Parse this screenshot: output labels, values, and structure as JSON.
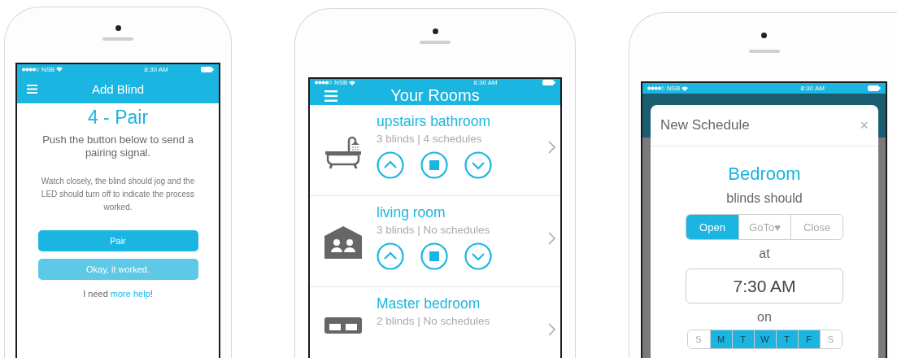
{
  "phones": [
    {
      "kind": "add_blind",
      "status": {
        "carrier": "NSB",
        "time": "8:30 AM"
      },
      "title": "Add Blind",
      "step": "4 - Pair",
      "instruction": "Push the button below to send a pairing signal.",
      "note": "Watch closely, the blind should jog and the LED should turn off to indicate the process worked.",
      "buttons": [
        {
          "label": "Pair",
          "disabled": false
        },
        {
          "label": "Okay, it worked.",
          "disabled": true
        }
      ],
      "help": {
        "before": "I need ",
        "link": "more help",
        "after": "!"
      }
    },
    {
      "kind": "rooms",
      "status": {
        "carrier": "NSB",
        "time": "8:30 AM"
      },
      "title": "Your Rooms",
      "rooms": [
        {
          "name": "upstairs bathroom",
          "info": "3 blinds | 4 schedules",
          "kind": "bathtub",
          "controls": true
        },
        {
          "name": "living room",
          "info": "3 blinds | No schedules",
          "kind": "house",
          "controls": true
        },
        {
          "name": "Master bedroom",
          "info": "2 blinds | No schedules",
          "kind": "bed",
          "controls": false
        }
      ]
    },
    {
      "kind": "schedule",
      "status": {
        "carrier": "NSB",
        "time": "8:30 AM"
      },
      "dialog": {
        "title": "New Schedule",
        "close": "×",
        "room": "Bedroom",
        "prompt": "blinds should",
        "actions": [
          {
            "label": "Open",
            "selected": true
          },
          {
            "label": "GoTo♥",
            "selected": false
          },
          {
            "label": "Close",
            "selected": false
          }
        ],
        "at": "at",
        "time": "7:30 AM",
        "on": "on",
        "days": [
          {
            "label": "S",
            "selected": false
          },
          {
            "label": "M",
            "selected": true
          },
          {
            "label": "T",
            "selected": true
          },
          {
            "label": "W",
            "selected": true
          },
          {
            "label": "T",
            "selected": true
          },
          {
            "label": "F",
            "selected": true
          },
          {
            "label": "S",
            "selected": false
          }
        ]
      }
    }
  ]
}
